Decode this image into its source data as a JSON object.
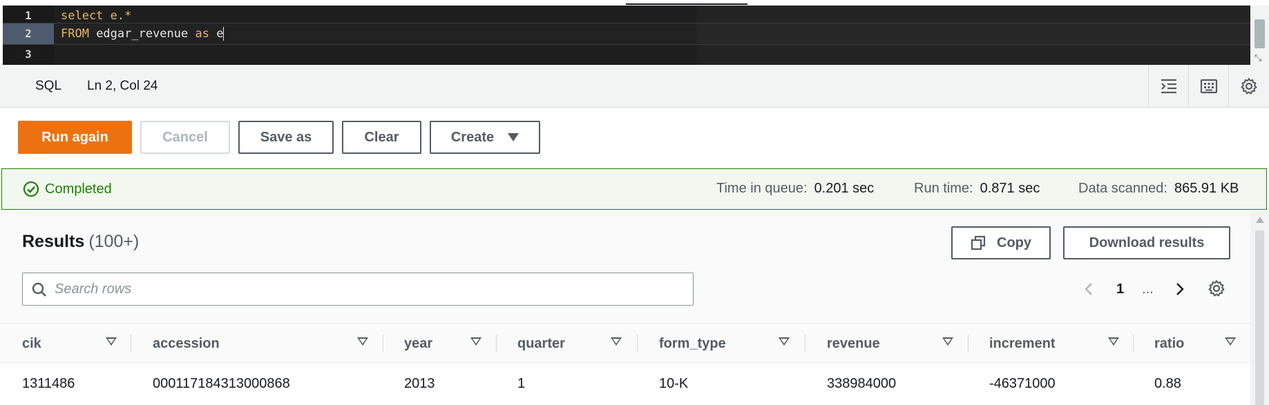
{
  "editor": {
    "lines": [
      {
        "number": "1",
        "tokens": [
          {
            "text": "select",
            "kind": "kw"
          },
          {
            "text": " e.*",
            "kind": "kw"
          }
        ]
      },
      {
        "number": "2",
        "tokens": [
          {
            "text": "FROM",
            "kind": "kw"
          },
          {
            "text": " edgar_revenue ",
            "kind": "id"
          },
          {
            "text": "as",
            "kind": "kw"
          },
          {
            "text": " e",
            "kind": "id"
          }
        ]
      },
      {
        "number": "3",
        "tokens": []
      }
    ],
    "active_line": 2
  },
  "statusbar": {
    "language": "SQL",
    "position": "Ln 2, Col 24",
    "icons": [
      "indent-icon",
      "keyboard-icon",
      "gear-icon"
    ]
  },
  "actions": {
    "run_again": "Run again",
    "cancel": "Cancel",
    "save_as": "Save as",
    "clear": "Clear",
    "create": "Create"
  },
  "status": {
    "state": "Completed",
    "time_in_queue_label": "Time in queue:",
    "time_in_queue_value": "0.201 sec",
    "run_time_label": "Run time:",
    "run_time_value": "0.871 sec",
    "data_scanned_label": "Data scanned:",
    "data_scanned_value": "865.91 KB",
    "color": "#1d8102"
  },
  "results": {
    "title": "Results",
    "count": "(100+)",
    "copy": "Copy",
    "download": "Download results",
    "search_placeholder": "Search rows",
    "page": "1",
    "ellipsis": "...",
    "columns": [
      "cik",
      "accession",
      "year",
      "quarter",
      "form_type",
      "revenue",
      "increment",
      "ratio"
    ],
    "rows": [
      [
        "1311486",
        "000117184313000868",
        "2013",
        "1",
        "10-K",
        "338984000",
        "-46371000",
        "0.88"
      ]
    ]
  },
  "colors": {
    "primary": "#ec7211",
    "editor_bg": "#1e1e1e",
    "keyword": "#e8b567"
  }
}
